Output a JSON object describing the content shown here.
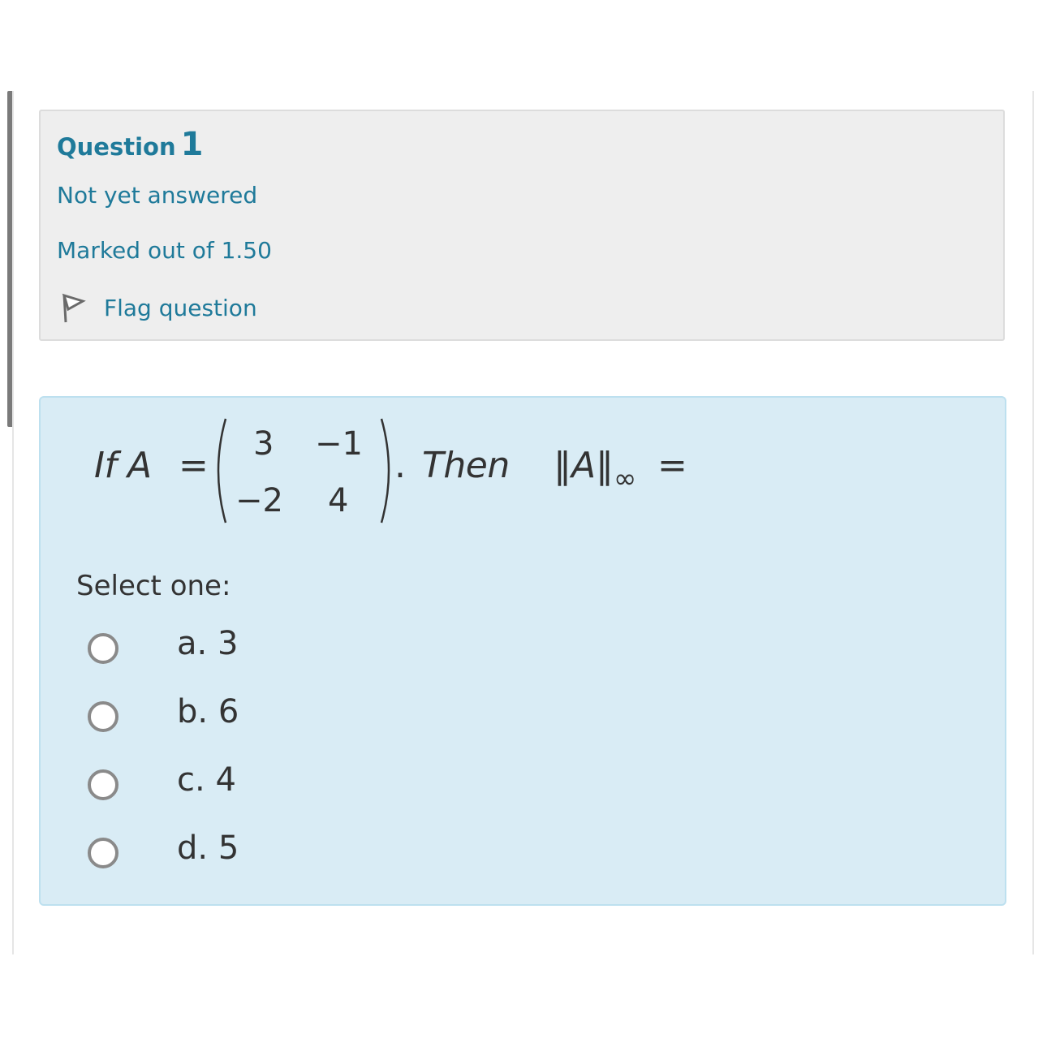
{
  "question_info": {
    "label": "Question",
    "number": "1",
    "state": "Not yet answered",
    "grade": "Marked out of 1.50",
    "flag_label": "Flag question"
  },
  "question": {
    "prefix": "If A",
    "equals": "=",
    "matrix": [
      [
        "3",
        "−1"
      ],
      [
        "−2",
        "4"
      ]
    ],
    "period": ".",
    "then": "Then",
    "norm_open": "‖",
    "norm_var": "A",
    "norm_close": "‖",
    "norm_sub": "∞",
    "trailing_equals": "="
  },
  "answer": {
    "prompt": "Select one:",
    "options": [
      {
        "letter": "a.",
        "value": "3"
      },
      {
        "letter": "b.",
        "value": "6"
      },
      {
        "letter": "c.",
        "value": "4"
      },
      {
        "letter": "d.",
        "value": "5"
      }
    ]
  },
  "colors": {
    "link": "#1f7a9a",
    "info_bg": "#eeeeee",
    "content_bg": "#d9ecf5",
    "text": "#333333",
    "radio_border": "#8a8a8a"
  },
  "icons": {
    "flag": "flag-icon",
    "radio": "radio-unchecked-icon"
  }
}
